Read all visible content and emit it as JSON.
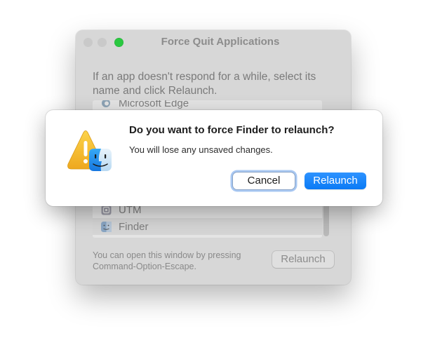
{
  "force_quit_window": {
    "title": "Force Quit Applications",
    "instructions": "If an app doesn't respond for a while, select its name and click Relaunch.",
    "apps": [
      {
        "name": "Microsoft Edge",
        "icon": "edge-icon"
      },
      {
        "name": "UTM",
        "icon": "utm-icon"
      },
      {
        "name": "Finder",
        "icon": "finder-icon",
        "selected": true
      }
    ],
    "hint": "You can open this window by pressing Command-Option-Escape.",
    "relaunch_label": "Relaunch"
  },
  "alert": {
    "title": "Do you want to force Finder to relaunch?",
    "message": "You will lose any unsaved changes.",
    "icon": "warning-finder-icon",
    "cancel_label": "Cancel",
    "relaunch_label": "Relaunch"
  },
  "colors": {
    "accent": "#0a7af5",
    "warning": "#f5b82e",
    "window_background": "#d7d7d7",
    "zoom_button": "#2ac840"
  }
}
